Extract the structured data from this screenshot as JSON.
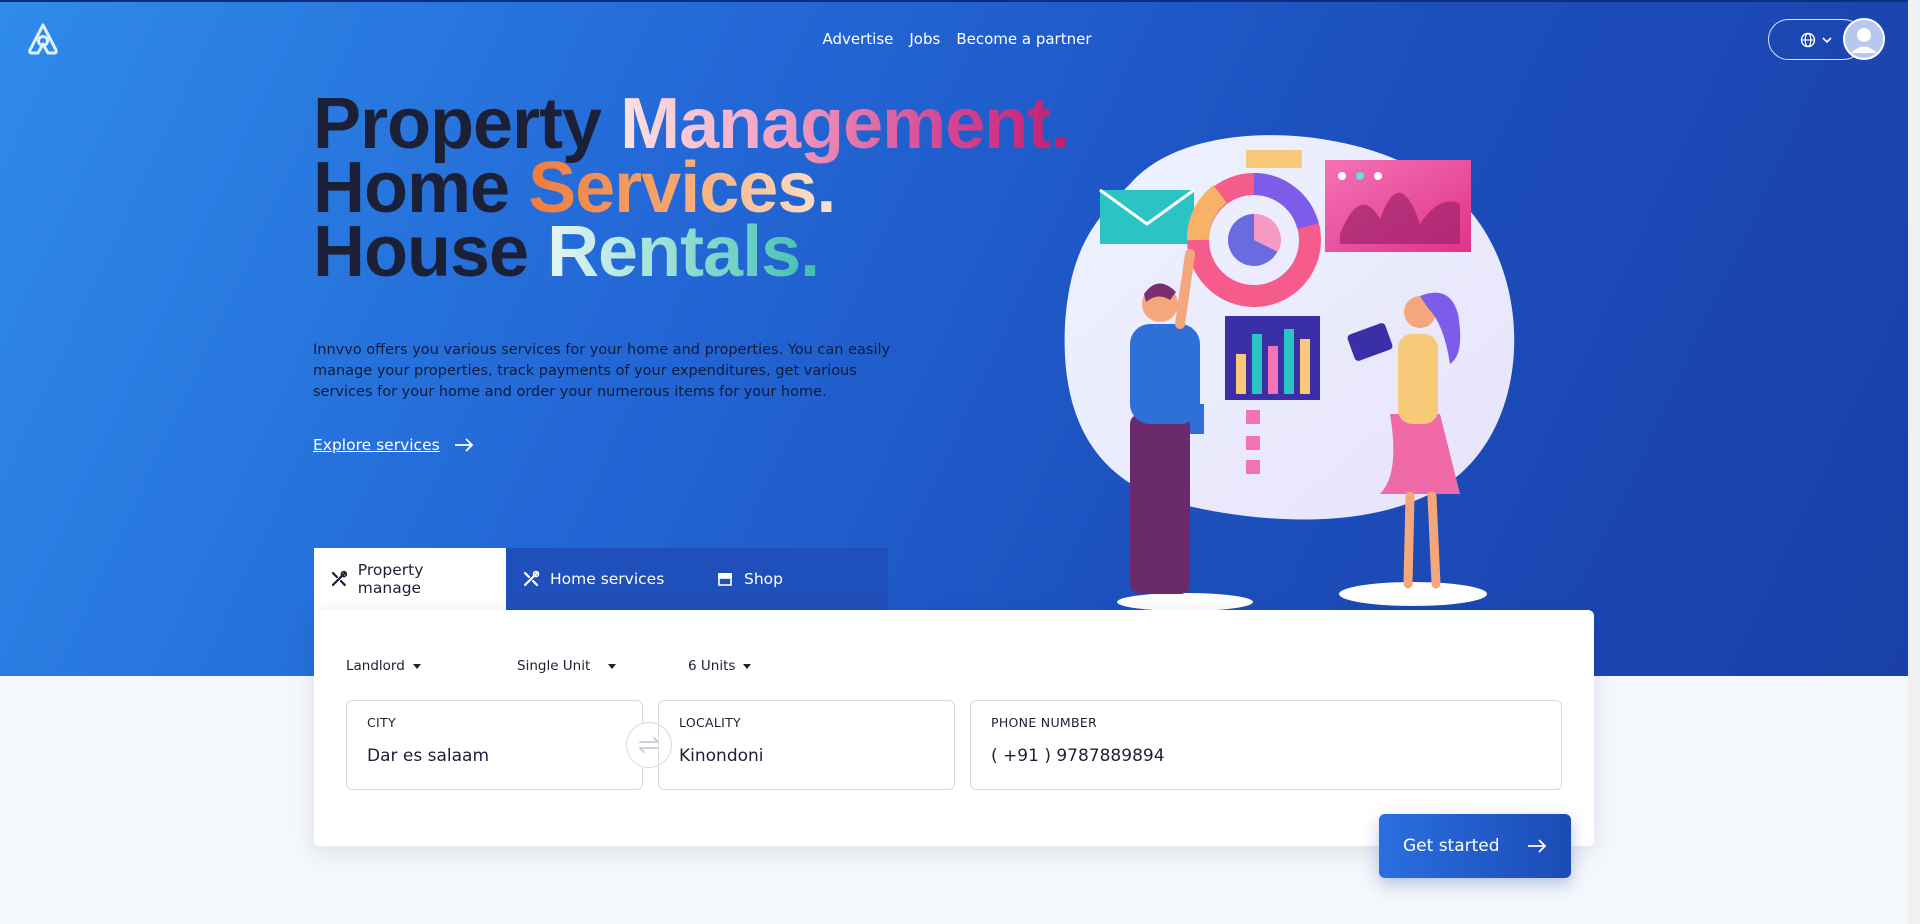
{
  "nav": {
    "links": [
      "Advertise",
      "Jobs",
      "Become a partner"
    ]
  },
  "headline": {
    "line1": {
      "dark": "Property",
      "accent": "Management."
    },
    "line2": {
      "dark": "Home",
      "accent": "Services."
    },
    "line3": {
      "dark": "House",
      "accent": "Rentals."
    }
  },
  "intro": "Innvvo offers you various services for your home and properties. You can easily manage your properties, track payments of your expenditures, get various services for your home and order your numerous items for your home.",
  "explore_label": "Explore services",
  "tabs": [
    {
      "label": "Property manage",
      "icon": "tools-icon"
    },
    {
      "label": "Home services",
      "icon": "tools-icon"
    },
    {
      "label": "Shop",
      "icon": "store-icon"
    }
  ],
  "filters": {
    "role": "Landlord",
    "unit_type": "Single Unit",
    "units": "6 Units"
  },
  "form": {
    "city": {
      "label": "CITY",
      "value": "Dar es salaam"
    },
    "locality": {
      "label": "LOCALITY",
      "value": "Kinondoni"
    },
    "phone": {
      "label": "PHONE NUMBER",
      "value": "( +91 ) 9787889894"
    }
  },
  "cta_label": "Get started",
  "colors": {
    "hero_start": "#2f8be9",
    "hero_end": "#1a3fa8",
    "heading_dark": "#1c2036",
    "cta": "#2a6fe0"
  }
}
